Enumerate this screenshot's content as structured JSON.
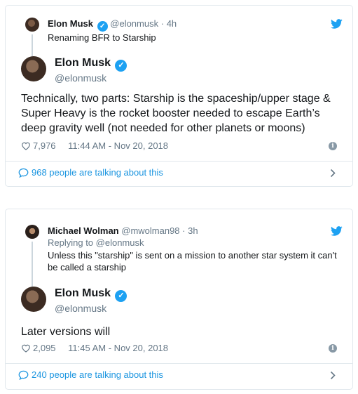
{
  "colors": {
    "accent": "#1da1f2",
    "link": "#1b95e0",
    "muted": "#657786",
    "border": "#e1e8ed"
  },
  "icons": [
    "twitter-bird-icon",
    "verified-badge-icon",
    "heart-icon",
    "info-icon",
    "speech-bubble-icon",
    "chevron-right-icon"
  ],
  "tweets": [
    {
      "parent": {
        "name": "Elon Musk",
        "handle": "@elonmusk",
        "dot": "·",
        "time": "4h",
        "text": "Renaming BFR to Starship"
      },
      "author": {
        "name": "Elon Musk",
        "handle": "@elonmusk"
      },
      "text": "Technically, two parts: Starship is the spaceship/upper stage & Super Heavy is the rocket booster needed to escape Earth’s deep gravity well (not needed for other planets or moons)",
      "likes": "7,976",
      "timestamp": "11:44 AM - Nov 20, 2018",
      "talking": "968 people are talking about this"
    },
    {
      "parent": {
        "name": "Michael Wolman",
        "handle": "@mwolman98",
        "dot": "·",
        "time": "3h",
        "replying": "Replying to @elonmusk",
        "text": "Unless this \"starship\" is sent on a mission to another star system it can't be called a starship"
      },
      "author": {
        "name": "Elon Musk",
        "handle": "@elonmusk"
      },
      "text": "Later versions will",
      "likes": "2,095",
      "timestamp": "11:45 AM - Nov 20, 2018",
      "talking": "240 people are talking about this"
    }
  ]
}
